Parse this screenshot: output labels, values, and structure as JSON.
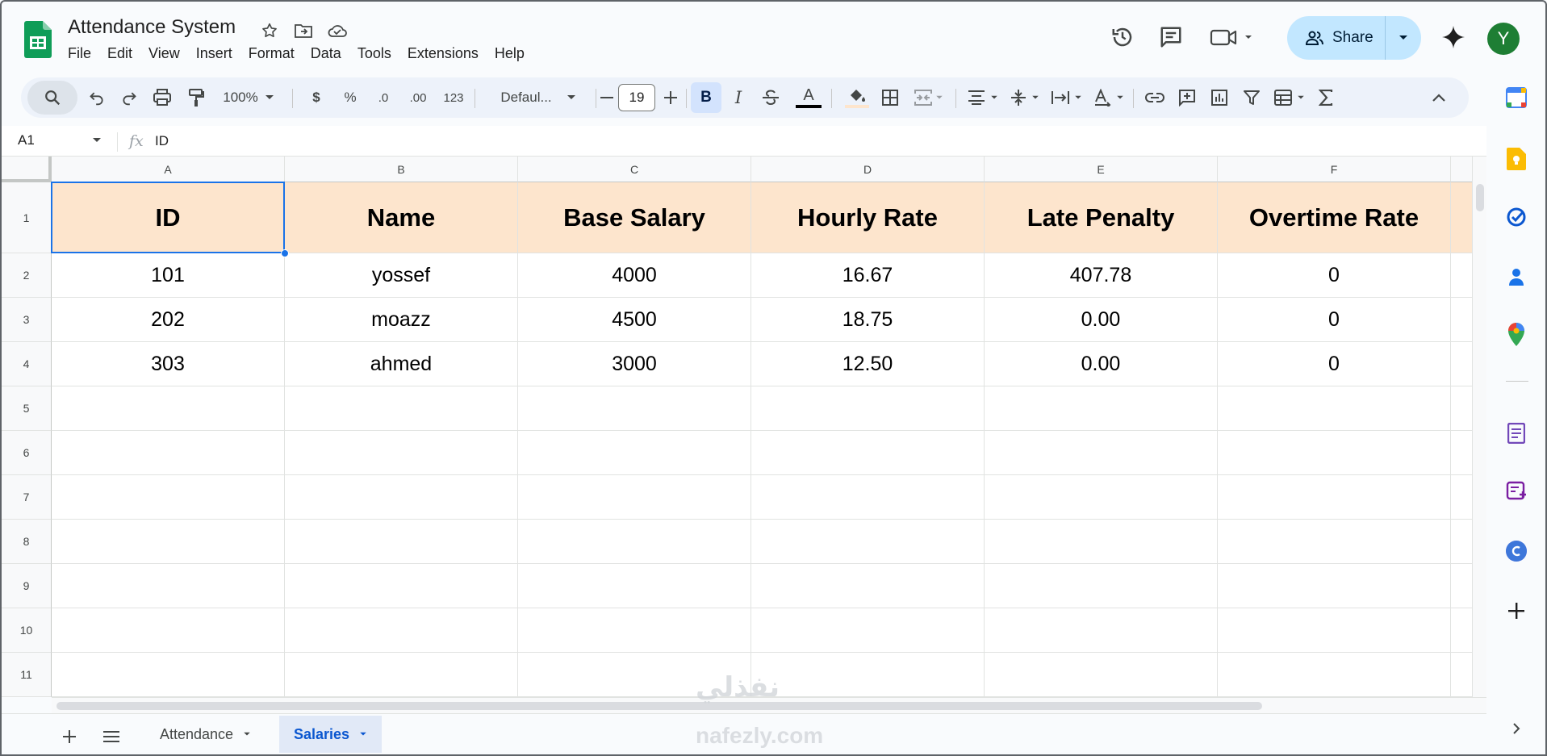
{
  "app": {
    "title": "Attendance System",
    "menu": [
      "File",
      "Edit",
      "View",
      "Insert",
      "Format",
      "Data",
      "Tools",
      "Extensions",
      "Help"
    ],
    "share_label": "Share",
    "avatar_initial": "Y",
    "brand_color": "#0f9d58"
  },
  "toolbar": {
    "zoom": "100%",
    "currency": "$",
    "percent": "%",
    "dec_decrease": ".0",
    "dec_increase": ".00",
    "number_format": "123",
    "font_family": "Defaul...",
    "font_size": "19",
    "bold": "B",
    "italic": "I",
    "text_color_letter": "A"
  },
  "formula_bar": {
    "cell_ref": "A1",
    "fx": "fx",
    "value": "ID"
  },
  "grid": {
    "column_letters": [
      "A",
      "B",
      "C",
      "D",
      "E",
      "F"
    ],
    "row_numbers": [
      "1",
      "2",
      "3",
      "4",
      "5",
      "6",
      "7",
      "8",
      "9",
      "10",
      "11"
    ],
    "headers": [
      "ID",
      "Name",
      "Base Salary",
      "Hourly Rate",
      "Late Penalty",
      "Overtime Rate"
    ],
    "rows": [
      [
        "101",
        "yossef",
        "4000",
        "16.67",
        "407.78",
        "0"
      ],
      [
        "202",
        "moazz",
        "4500",
        "18.75",
        "0.00",
        "0"
      ],
      [
        "303",
        "ahmed",
        "3000",
        "12.50",
        "0.00",
        "0"
      ]
    ],
    "header_fill": "#fde5cd",
    "selected_cell": "A1"
  },
  "sheets": {
    "tabs": [
      "Attendance",
      "Salaries"
    ],
    "active": "Salaries"
  },
  "watermark": {
    "arabic": "نفذلي",
    "latin": "nafezly.com"
  },
  "icons": {
    "title": [
      "star-icon",
      "move-folder-icon",
      "cloud-saved-icon"
    ],
    "header": [
      "history-icon",
      "comments-icon",
      "meet-icon",
      "people-icon",
      "gemini-icon"
    ],
    "side_panel": [
      "calendar-icon",
      "keep-icon",
      "tasks-icon",
      "contacts-icon",
      "maps-icon",
      "forms-icon",
      "appsheet-icon",
      "canva-icon",
      "add-icon",
      "expand-icon"
    ]
  }
}
